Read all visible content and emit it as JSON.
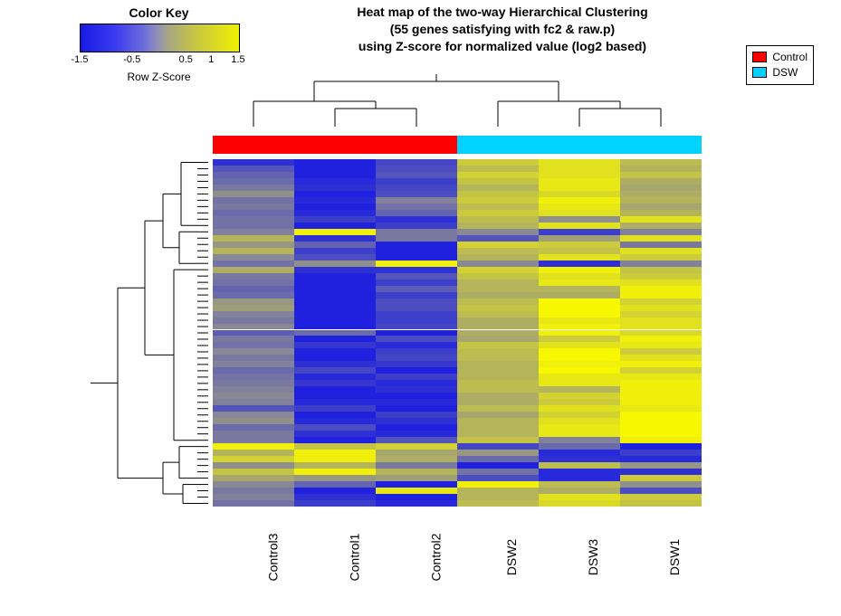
{
  "color_key": {
    "title": "Color Key",
    "axis_ticks": [
      "-1.5",
      "-0.5",
      "0.5",
      "1",
      "1.5"
    ],
    "subtitle": "Row Z-Score"
  },
  "title": {
    "line1": "Heat map of the two-way Hierarchical Clustering",
    "line2": "(55 genes satisfying with fc2 & raw.p)",
    "line3": "using Z-score for normalized value (log2 based)"
  },
  "group_legend": {
    "control": {
      "label": "Control",
      "color": "#ff0000"
    },
    "dsw": {
      "label": "DSW",
      "color": "#00d2ff"
    }
  },
  "samples": [
    "Control3",
    "Control1",
    "Control2",
    "DSW2",
    "DSW3",
    "DSW1"
  ],
  "chart_data": {
    "type": "heatmap",
    "info": "Rows are 55 genes (not labeled). Columns are 6 samples. Values are row Z-scores (log2-based), roughly in [-1.5, 1.5]. Blue = negative Z, Yellow = positive Z. Control samples cluster on the left (mostly blue / down-regulated), DSW samples on the right (mostly yellow / up-regulated), with a minority (~8 rows) showing the opposite pattern.",
    "x": [
      "Control3",
      "Control1",
      "Control2",
      "DSW2",
      "DSW3",
      "DSW1"
    ],
    "x_groups": [
      "Control",
      "Control",
      "Control",
      "DSW",
      "DSW",
      "DSW"
    ],
    "legend": {
      "Control": "#ff0000",
      "DSW": "#00d2ff"
    },
    "color_scale": {
      "min": -1.5,
      "mid": 0,
      "max": 1.5,
      "low_color": "#181ae4",
      "mid_color": "#8888aa",
      "high_color": "#f7f700"
    },
    "z": [
      [
        -1.2,
        -1.4,
        -0.9,
        0.9,
        1.2,
        0.7
      ],
      [
        -0.7,
        -1.4,
        -0.8,
        0.7,
        1.2,
        0.6
      ],
      [
        -0.5,
        -1.4,
        -0.7,
        1.0,
        1.2,
        0.8
      ],
      [
        -0.4,
        -1.3,
        -1.0,
        0.8,
        1.3,
        0.5
      ],
      [
        -0.2,
        -1.2,
        -0.9,
        0.6,
        1.3,
        0.4
      ],
      [
        0.1,
        -1.4,
        -0.8,
        0.8,
        1.1,
        0.5
      ],
      [
        -0.3,
        -1.3,
        -0.1,
        0.9,
        1.4,
        0.6
      ],
      [
        -0.2,
        -1.4,
        -0.3,
        0.7,
        1.3,
        0.4
      ],
      [
        -0.4,
        -1.3,
        -0.5,
        0.9,
        1.2,
        0.6
      ],
      [
        -0.3,
        -1.0,
        -1.2,
        0.7,
        0.1,
        1.2
      ],
      [
        -0.3,
        -1.4,
        -1.0,
        0.6,
        1.2,
        0.5
      ],
      [
        -0.1,
        1.4,
        -0.2,
        0.0,
        -1.0,
        -0.1
      ],
      [
        0.6,
        -1.2,
        -0.2,
        -0.7,
        0.3,
        1.2
      ],
      [
        0.2,
        -0.5,
        -1.4,
        1.0,
        0.9,
        -0.2
      ],
      [
        0.6,
        -1.0,
        -1.4,
        0.7,
        0.8,
        1.2
      ],
      [
        0.0,
        -0.8,
        -1.4,
        0.6,
        1.2,
        0.9
      ],
      [
        -0.3,
        0.1,
        1.4,
        0.0,
        -1.2,
        -0.1
      ],
      [
        0.5,
        -1.2,
        -1.2,
        1.0,
        1.4,
        0.8
      ],
      [
        -0.2,
        -1.4,
        -0.7,
        0.8,
        1.2,
        0.9
      ],
      [
        -0.3,
        -1.4,
        -1.0,
        0.6,
        1.3,
        1.2
      ],
      [
        -0.5,
        -1.4,
        -0.6,
        0.6,
        0.6,
        1.4
      ],
      [
        -0.4,
        -1.4,
        -1.0,
        0.5,
        0.5,
        1.4
      ],
      [
        0.2,
        -1.4,
        -0.8,
        0.7,
        1.5,
        1.0
      ],
      [
        0.3,
        -1.4,
        -0.8,
        0.8,
        1.5,
        1.2
      ],
      [
        -0.1,
        -1.4,
        -1.0,
        0.7,
        1.5,
        1.0
      ],
      [
        -0.2,
        -1.4,
        -1.0,
        0.5,
        1.3,
        1.2
      ],
      [
        0.0,
        -1.4,
        -0.9,
        0.5,
        1.4,
        1.2
      ],
      [
        -0.6,
        -0.4,
        -1.4,
        0.5,
        1.4,
        1.1
      ],
      [
        -0.2,
        -1.4,
        -0.8,
        0.4,
        0.9,
        1.4
      ],
      [
        -0.3,
        -1.1,
        -1.3,
        0.8,
        1.2,
        1.3
      ],
      [
        0.0,
        -1.4,
        -1.0,
        0.7,
        1.5,
        0.9
      ],
      [
        -0.2,
        -1.4,
        -0.9,
        0.7,
        1.5,
        1.2
      ],
      [
        -0.1,
        -1.2,
        -1.1,
        0.6,
        1.4,
        1.4
      ],
      [
        -0.4,
        -0.9,
        -1.4,
        0.6,
        1.5,
        1.0
      ],
      [
        -0.3,
        -1.3,
        -1.0,
        0.6,
        1.3,
        1.3
      ],
      [
        -0.2,
        -1.1,
        -1.3,
        0.7,
        1.3,
        1.4
      ],
      [
        -0.1,
        -1.4,
        -1.2,
        0.7,
        0.6,
        1.4
      ],
      [
        0.0,
        -1.4,
        -1.4,
        0.5,
        1.0,
        1.4
      ],
      [
        -0.1,
        -1.3,
        -1.3,
        0.5,
        0.9,
        1.4
      ],
      [
        -0.7,
        -1.0,
        -1.4,
        0.7,
        1.2,
        1.3
      ],
      [
        0.0,
        -1.4,
        -1.0,
        0.4,
        1.0,
        1.5
      ],
      [
        0.1,
        -1.3,
        -1.2,
        0.6,
        1.2,
        1.5
      ],
      [
        -0.4,
        -0.8,
        -1.4,
        0.6,
        1.3,
        1.5
      ],
      [
        -0.2,
        -1.2,
        -1.3,
        0.6,
        1.3,
        1.5
      ],
      [
        -0.2,
        -1.4,
        -0.7,
        0.8,
        -0.1,
        1.4
      ],
      [
        1.4,
        0.8,
        1.0,
        -0.9,
        -0.4,
        -1.4
      ],
      [
        0.6,
        1.4,
        0.4,
        0.2,
        -1.3,
        -1.0
      ],
      [
        1.0,
        1.4,
        0.5,
        -0.4,
        -1.2,
        -1.3
      ],
      [
        0.1,
        0.6,
        -0.2,
        -1.4,
        0.7,
        0.2
      ],
      [
        0.8,
        1.4,
        0.6,
        -0.3,
        -1.3,
        -1.2
      ],
      [
        0.4,
        0.2,
        0.3,
        -0.8,
        -1.3,
        0.9
      ],
      [
        0.0,
        -0.5,
        -1.4,
        1.4,
        0.7,
        0.1
      ],
      [
        -0.2,
        -1.4,
        1.3,
        0.6,
        0.5,
        -0.8
      ],
      [
        -0.1,
        -1.2,
        -1.4,
        0.6,
        1.2,
        0.9
      ],
      [
        -0.3,
        -1.0,
        -1.3,
        0.7,
        1.1,
        0.8
      ]
    ]
  }
}
